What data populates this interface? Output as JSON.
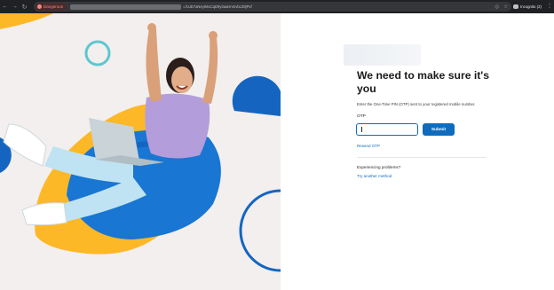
{
  "browser": {
    "security_chip_label": "Dangerous",
    "url_tail": "=/1UE7aNeyIMxCqD9y3aaHnmvbcZ8jPvf",
    "incognito_label": "Incognito (2)"
  },
  "form": {
    "title": "We need to make sure it's you",
    "subtitle": "Enter the One-Time PIN (OTP) sent to your registered mobile number.",
    "otp_label": "OTP",
    "otp_value": "",
    "submit_label": "Submit",
    "resend_label": "Resend OTP",
    "problems_label": "Experiencing problems?",
    "try_another_label": "Try another method"
  },
  "colors": {
    "primary": "#0f6cbd",
    "accent_yellow": "#fdb827",
    "accent_blue": "#1565c0",
    "accent_teal": "#5ec7cf",
    "hero_background": "#f2efee"
  }
}
